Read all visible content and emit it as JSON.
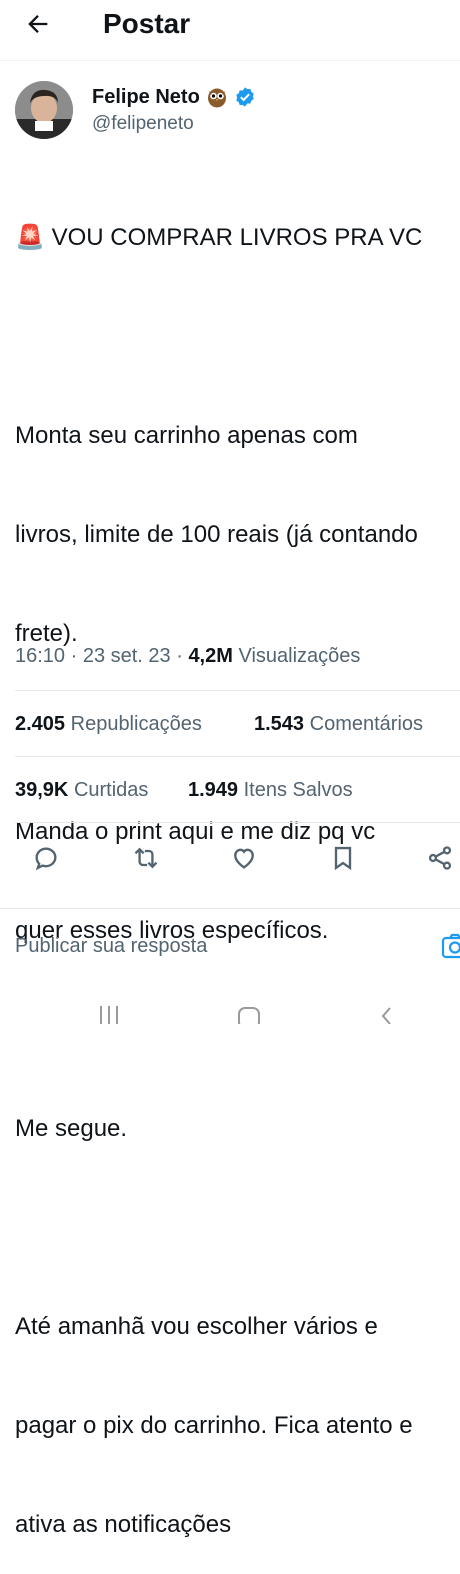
{
  "header": {
    "title": "Postar"
  },
  "author": {
    "name": "Felipe Neto",
    "handle": "@felipeneto"
  },
  "tweet": {
    "emoji": "🚨",
    "lines": [
      "VOU COMPRAR LIVROS PRA VC",
      "",
      "Monta seu carrinho apenas com",
      "livros, limite de 100 reais (já contando",
      "frete).",
      "",
      "Manda o print aqui e me diz pq vc",
      "quer esses livros específicos.",
      "",
      "Me segue.",
      "",
      "Até amanhã vou escolher vários e",
      "pagar o pix do carrinho. Fica atento e",
      "ativa as notificações"
    ]
  },
  "meta": {
    "time": "16:10 · 23 set. 23 · ",
    "views_count": "4,2M",
    "views_label": " Visualizações"
  },
  "stats": {
    "reposts_count": "2.405",
    "reposts_label": "Republicações",
    "comments_count": "1.543",
    "comments_label": "Comentários",
    "likes_count": "39,9K",
    "likes_label": "Curtidas",
    "saves_count": "1.949",
    "saves_label": "Itens Salvos"
  },
  "actions": [
    "reply-icon",
    "repost-icon",
    "like-icon",
    "bookmark-icon",
    "share-icon"
  ],
  "reply": {
    "placeholder": "Publicar sua resposta"
  },
  "colors": {
    "verified": "#1d9bf0",
    "secondary_text": "#536471",
    "camera": "#1d9bf0"
  }
}
